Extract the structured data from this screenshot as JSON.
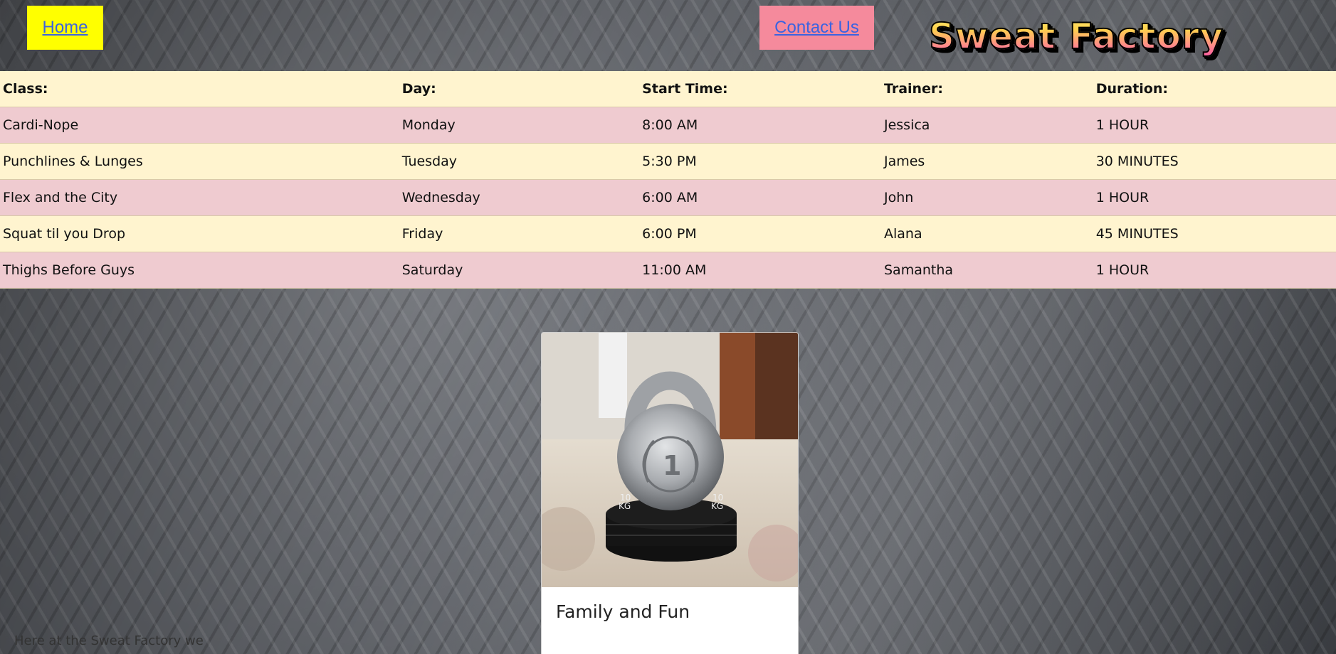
{
  "nav": {
    "home_label": "Home",
    "contact_label": "Contact Us"
  },
  "logo": {
    "text": "Sweat Factory"
  },
  "schedule": {
    "headers": [
      "Class:",
      "Day:",
      "Start Time:",
      "Trainer:",
      "Duration:"
    ],
    "rows": [
      [
        "Cardi-Nope",
        "Monday",
        "8:00 AM",
        "Jessica",
        "1 HOUR"
      ],
      [
        "Punchlines & Lunges",
        "Tuesday",
        "5:30 PM",
        "James",
        "30 MINUTES"
      ],
      [
        "Flex and the City",
        "Wednesday",
        "6:00 AM",
        "John",
        "1 HOUR"
      ],
      [
        "Squat til you Drop",
        "Friday",
        "6:00 PM",
        "Alana",
        "45 MINUTES"
      ],
      [
        "Thighs Before Guys",
        "Saturday",
        "11:00 AM",
        "Samantha",
        "1 HOUR"
      ]
    ]
  },
  "card": {
    "title": "Family and Fun",
    "text": "Here at the Sweat Factory we",
    "image_icon": "kettlebell-trophy-photo"
  },
  "colors": {
    "home_bg": "#ffff00",
    "contact_bg": "#f58a9c",
    "link": "#3b63e0",
    "row_cream": "#fff4cf",
    "row_pink": "#efcbd0"
  }
}
